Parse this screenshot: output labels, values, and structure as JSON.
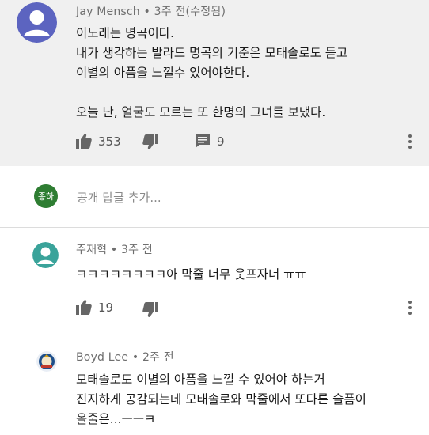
{
  "comment1": {
    "author": "Jay Mensch",
    "time": "• 3주 전(수정됨)",
    "lines": [
      "이노래는 명곡이다.",
      "내가 생각하는 발라드 명곡의 기준은 모태솔로도 듣고",
      "이별의 아픔을 느낄수 있어야한다.",
      "",
      "오늘 난, 얼굴도 모르는 또 한명의 그녀를 보냈다."
    ],
    "likes": "353",
    "replies": "9"
  },
  "reply_box": {
    "avatar_text": "종하",
    "placeholder": "공개 답글 추가..."
  },
  "comment2": {
    "author": "주재혁",
    "time": "• 3주 전",
    "lines": [
      "ㅋㅋㅋㅋㅋㅋㅋㅋ아 막줄 너무 웃프자너 ㅠㅠ"
    ],
    "likes": "19"
  },
  "comment3": {
    "author": "Boyd Lee",
    "time": "• 2주 전",
    "lines": [
      "모태솔로도 이별의 아픔을 느낄 수 있어야 하는거",
      "진지하게 공감되는데 모태솔로와 막줄에서 또다른 슬픔이",
      "올줄은...ㅡㅡㅋ"
    ]
  },
  "colors": {
    "top_background": "#f0f0f0",
    "avatar_purple": "#5c64c0",
    "reply_avatar_green": "#2e7d32",
    "avatar_teal": "#3aa39a"
  }
}
